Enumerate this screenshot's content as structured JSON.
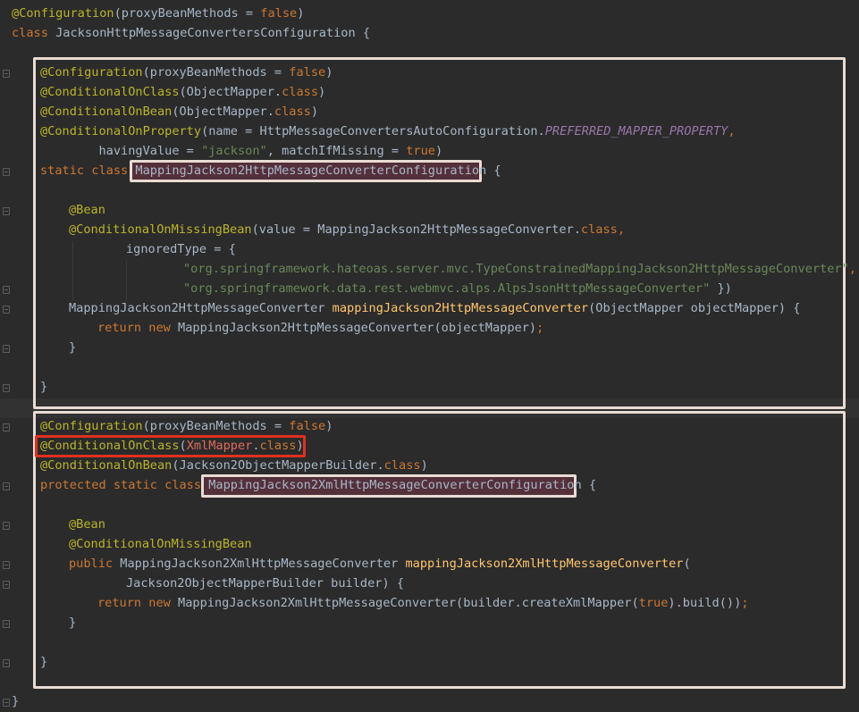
{
  "editor": {
    "header": {
      "ann": "@Configuration",
      "ann_args": "(proxyBeanMethods = ",
      "ann_false": "false",
      "ann_close": ")",
      "class_kw": "class ",
      "class_name": "JacksonHttpMessageConvertersConfiguration {"
    },
    "block1": {
      "l1_ann": "@Configuration",
      "l1_args": "(proxyBeanMethods = ",
      "l1_false": "false",
      "l1_close": ")",
      "l2_ann": "@ConditionalOnClass",
      "l2_args": "(ObjectMapper.",
      "l2_class": "class",
      "l2_close": ")",
      "l3_ann": "@ConditionalOnBean",
      "l3_args": "(ObjectMapper.",
      "l3_class": "class",
      "l3_close": ")",
      "l4_ann": "@ConditionalOnProperty",
      "l4_args": "(name = HttpMessageConvertersAutoConfiguration.",
      "l4_const": "PREFERRED_MAPPER_PROPERTY",
      "l4_comma": ",",
      "l5_pre": "        havingValue = ",
      "l5_str": "\"jackson\"",
      "l5_mid": ", matchIfMissing = ",
      "l5_true": "true",
      "l5_close": ")",
      "l6_kw": "static class ",
      "l6_name": "MappingJackson2HttpMessageConverterConfiguration",
      "l6_brace": " {",
      "l7_ann": "@Bean",
      "l8_ann": "@ConditionalOnMissingBean",
      "l8_args": "(value = MappingJackson2HttpMessageConverter.",
      "l8_class": "class",
      "l8_comma": ",",
      "l9_text": "ignoredType = {",
      "l10_str": "\"org.springframework.hateoas.server.mvc.TypeConstrainedMappingJackson2HttpMessageConverter\"",
      "l10_comma": ",",
      "l11_str": "\"org.springframework.data.rest.webmvc.alps.AlpsJsonHttpMessageConverter\"",
      "l11_close": " })",
      "l12_type": "MappingJackson2HttpMessageConverter ",
      "l12_fn": "mappingJackson2HttpMessageConverter",
      "l12_args": "(ObjectMapper objectMapper) {",
      "l13_return": "return ",
      "l13_new": "new ",
      "l13_rest": "MappingJackson2HttpMessageConverter(objectMapper)",
      "l13_semi": ";",
      "l14_brace": "}",
      "l15_brace": "}"
    },
    "block2": {
      "l1_ann": "@Configuration",
      "l1_args": "(proxyBeanMethods = ",
      "l1_false": "false",
      "l1_close": ")",
      "l2_ann": "@ConditionalOnClass",
      "l2_open": "(",
      "l2_xml": "XmlMapper",
      "l2_dot": ".",
      "l2_class": "class",
      "l2_close": ")",
      "l3_ann": "@ConditionalOnBean",
      "l3_args": "(Jackson2ObjectMapperBuilder.",
      "l3_class": "class",
      "l3_close": ")",
      "l4_kw": "protected static class ",
      "l4_name": "MappingJackson2XmlHttpMessageConverterConfiguration",
      "l4_brace": " {",
      "l5_ann": "@Bean",
      "l6_ann": "@ConditionalOnMissingBean",
      "l7_kw": "public ",
      "l7_type": "MappingJackson2XmlHttpMessageConverter ",
      "l7_fn": "mappingJackson2XmlHttpMessageConverter",
      "l7_open": "(",
      "l8_text": "Jackson2ObjectMapperBuilder builder) {",
      "l9_return": "return ",
      "l9_new": "new ",
      "l9_rest": "MappingJackson2XmlHttpMessageConverter(builder.createXmlMapper(",
      "l9_true": "true",
      "l9_end": ").build())",
      "l9_semi": ";",
      "l10_brace": "}",
      "l11_brace": "}"
    },
    "footer": {
      "close_brace": "}"
    },
    "colors": {
      "background": "#2b2b2b",
      "annotation": "#bbb529",
      "keyword": "#cc7832",
      "string": "#6a8759",
      "method": "#ffc66d",
      "constant": "#9876aa",
      "text": "#a9b7c6",
      "highlight_border": "#e8dcd4",
      "red_border": "#e0301e"
    }
  }
}
